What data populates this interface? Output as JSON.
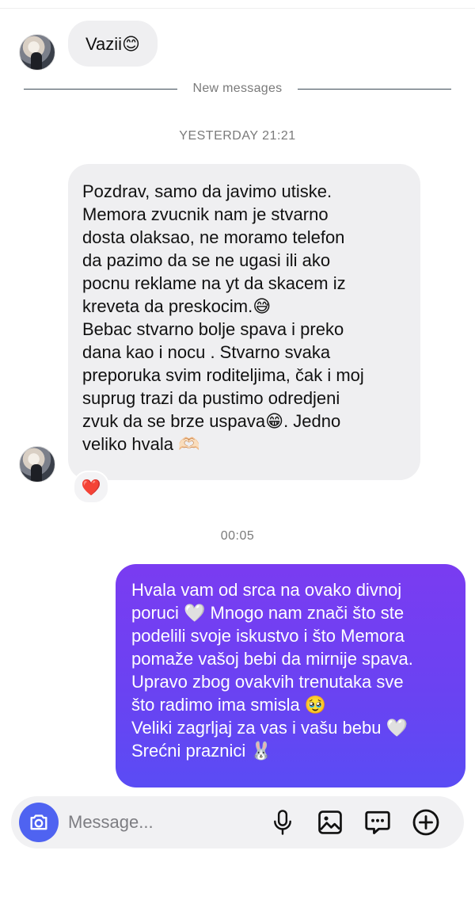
{
  "messages": {
    "first": {
      "text": "Vazii😊"
    },
    "divider": "New messages",
    "timestamp_1": "YESTERDAY 21:21",
    "incoming": {
      "lines": [
        "Pozdrav, samo da javimo utiske.",
        "Memora zvucnik nam je stvarno",
        "dosta olaksao, ne moramo telefon",
        "da pazimo da se ne ugasi ili ako",
        "pocnu reklame na yt da skacem iz",
        "kreveta da preskocim.😅",
        "Bebac stvarno bolje spava i preko",
        "dana kao i nocu . Stvarno svaka",
        "preporuka svim roditeljima, čak i moj",
        "suprug trazi da pustimo odredjeni",
        "zvuk da se brze uspava😁. Jedno",
        "veliko hvala 🫶🏻"
      ],
      "reaction": "❤️"
    },
    "timestamp_2": "00:05",
    "outgoing": {
      "lines": [
        "Hvala vam od srca na ovako divnoj",
        "poruci 🤍 Mnogo nam znači što ste",
        "podelili svoje iskustvo i što Memora",
        "pomaže vašoj bebi da mirnije spava.",
        "Upravo zbog ovakvih trenutaka sve",
        "što radimo ima smisla 🥹",
        "Veliki zagrljaj za vas i vašu bebu 🤍",
        "Srećni praznici 🐰"
      ]
    }
  },
  "composer": {
    "placeholder": "Message...",
    "icons": [
      "camera-icon",
      "microphone-icon",
      "gallery-icon",
      "sticker-chat-icon",
      "plus-circle-icon"
    ]
  },
  "colors": {
    "outgoing_bubble_top": "#7a3cf1",
    "outgoing_bubble_bottom": "#5a4cf4",
    "incoming_bubble": "#efeff1",
    "camera_button": "#4f63f1"
  }
}
